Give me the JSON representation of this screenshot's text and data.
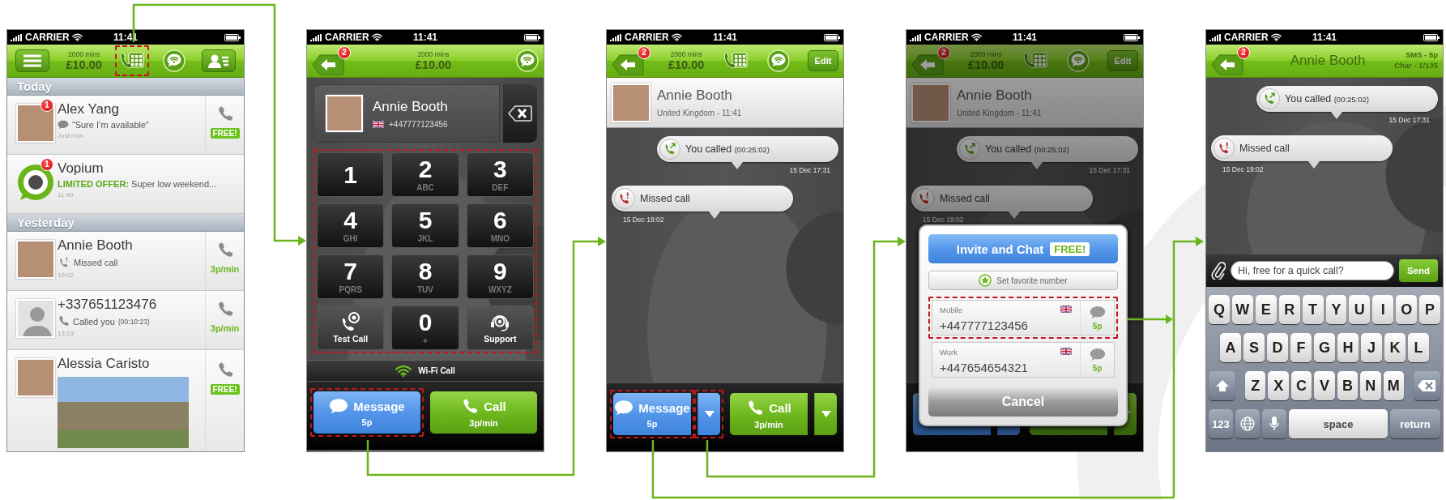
{
  "screens": [
    {
      "kind": "call_log",
      "status_bar": {
        "carrier": "CARRIER",
        "time": "11:41"
      },
      "header": [
        {
          "kind": "menu",
          "highlighted": false
        },
        {
          "kind": "credit",
          "minutes": "2000 mins",
          "balance": "£10.00",
          "highlighted": false
        },
        {
          "kind": "dialpad",
          "highlighted": true
        },
        {
          "kind": "wifi",
          "highlighted": false
        },
        {
          "kind": "contacts",
          "highlighted": false
        }
      ],
      "sections": [
        {
          "title": "Today",
          "items": [
            {
              "kind": "message",
              "avatar": {
                "kind": "photo"
              },
              "badge": "1",
              "name": "Alex Yang",
              "detail": "“Sure I’m available”",
              "time": "Just now",
              "rate": {
                "kind": "badge",
                "text": "FREE!"
              }
            },
            {
              "kind": "promo",
              "avatar": {
                "kind": "logo"
              },
              "badge": "1",
              "name": "Vopium",
              "detail": "**LIMITED OFFER:** Super low weekend...",
              "time": "11:40"
            }
          ]
        },
        {
          "title": "Yesterday",
          "items": [
            {
              "kind": "missed",
              "avatar": {
                "kind": "photo"
              },
              "name": "Annie Booth",
              "detail": "Missed call",
              "time": "19:02",
              "rate": {
                "kind": "text",
                "text": "3p/min"
              }
            },
            {
              "kind": "incoming",
              "avatar": {
                "kind": "silhouette"
              },
              "name": "+337651123476",
              "detail": "Called you",
              "duration": "(00:10:23)",
              "time": "13:23",
              "rate": {
                "kind": "text",
                "text": "3p/min"
              }
            },
            {
              "kind": "photo",
              "avatar": {
                "kind": "photo"
              },
              "name": "Alessia Caristo",
              "rate": {
                "kind": "badge",
                "text": "FREE!"
              }
            }
          ]
        }
      ]
    },
    {
      "kind": "dialer",
      "status_bar": {
        "carrier": "CARRIER",
        "time": "11:41"
      },
      "header": [
        {
          "kind": "back",
          "badge": "2"
        },
        {
          "kind": "credit",
          "minutes": "2000 mins",
          "balance": "£10.00"
        },
        {
          "kind": "wifi"
        }
      ],
      "contact": {
        "name": "Annie Booth",
        "number": "+447777123456"
      },
      "keypad": {
        "highlighted": true,
        "keys": [
          {
            "kind": "digit",
            "digit": "1"
          },
          {
            "kind": "digit",
            "digit": "2",
            "letters": "ABC"
          },
          {
            "kind": "digit",
            "digit": "3",
            "letters": "DEF"
          },
          {
            "kind": "digit",
            "digit": "4",
            "letters": "GHI"
          },
          {
            "kind": "digit",
            "digit": "5",
            "letters": "JKL"
          },
          {
            "kind": "digit",
            "digit": "6",
            "letters": "MNO"
          },
          {
            "kind": "digit",
            "digit": "7",
            "letters": "PQRS"
          },
          {
            "kind": "digit",
            "digit": "8",
            "letters": "TUV"
          },
          {
            "kind": "digit",
            "digit": "9",
            "letters": "WXYZ"
          },
          {
            "kind": "test_call",
            "label": "Test Call"
          },
          {
            "kind": "digit",
            "digit": "0",
            "letters": "+"
          },
          {
            "kind": "support",
            "label": "Support"
          }
        ]
      },
      "call_mode": "Wi-Fi Call",
      "buttons": [
        {
          "kind": "message",
          "label": "Message",
          "price": "5p",
          "dropdown": false,
          "highlighted": true
        },
        {
          "kind": "call",
          "label": "Call",
          "price": "3p/min",
          "dropdown": false,
          "highlighted": false
        }
      ]
    },
    {
      "kind": "conversation",
      "status_bar": {
        "carrier": "CARRIER",
        "time": "11:41"
      },
      "header": [
        {
          "kind": "back",
          "badge": "2"
        },
        {
          "kind": "credit",
          "minutes": "2000 mins",
          "balance": "£10.00"
        },
        {
          "kind": "dialpad"
        },
        {
          "kind": "wifi"
        },
        {
          "kind": "edit",
          "label": "Edit"
        }
      ],
      "contact": {
        "name": "Annie Booth",
        "subtitle": "United Kingdom - 11:41"
      },
      "messages": [
        {
          "kind": "outgoing",
          "text": "You called",
          "duration": "(00:25:02)",
          "time": "15 Dec 17:31"
        },
        {
          "kind": "missed",
          "text": "Missed call",
          "time": "15 Dec 19:02"
        }
      ],
      "buttons": [
        {
          "kind": "message",
          "label": "Message",
          "price": "5p",
          "dropdown": true,
          "highlighted": true,
          "dropdown_highlighted": true
        },
        {
          "kind": "call",
          "label": "Call",
          "price": "3p/min",
          "dropdown": true,
          "highlighted": false,
          "dropdown_highlighted": false
        }
      ]
    },
    {
      "kind": "number_picker",
      "status_bar": {
        "carrier": "CARRIER",
        "time": "11:41"
      },
      "header": [
        {
          "kind": "back",
          "badge": "2"
        },
        {
          "kind": "credit",
          "minutes": "2000 mins",
          "balance": "£10.00"
        },
        {
          "kind": "dialpad"
        },
        {
          "kind": "wifi"
        },
        {
          "kind": "edit",
          "label": "Edit"
        }
      ],
      "contact": {
        "name": "Annie Booth",
        "subtitle": "United Kingdom - 11:41"
      },
      "messages": [
        {
          "kind": "outgoing",
          "text": "You called",
          "duration": "(00:25:02)",
          "time": "15 Dec 17:31"
        },
        {
          "kind": "missed",
          "text": "Missed call",
          "time": "15 Dec 19:02"
        }
      ],
      "buttons": [
        {
          "kind": "message",
          "dropdown": true
        },
        {
          "kind": "call",
          "dropdown": true
        }
      ],
      "popup": {
        "invite": "Invite and Chat",
        "invite_badge": "FREE!",
        "favorite": "Set favorite number",
        "numbers": [
          {
            "label": "Mobile",
            "number": "+447777123456",
            "price": "5p",
            "highlighted": true
          },
          {
            "label": "Work",
            "number": "+447654654321",
            "price": "5p",
            "highlighted": false
          }
        ],
        "cancel": "Cancel"
      }
    },
    {
      "kind": "compose",
      "status_bar": {
        "carrier": "CARRIER",
        "time": "11:41"
      },
      "header": [
        {
          "kind": "back",
          "badge": "2"
        },
        {
          "kind": "title",
          "text": "Annie Booth"
        },
        {
          "kind": "sms_info",
          "lines": [
            "SMS - 5p",
            "Char - 1/135"
          ]
        }
      ],
      "messages": [
        {
          "kind": "outgoing",
          "text": "You called",
          "duration": "(00:25:02)",
          "time": "15 Dec 17:31"
        },
        {
          "kind": "missed",
          "text": "Missed call",
          "time": "15 Dec 19:02"
        }
      ],
      "composer": {
        "value": "Hi, free for a quick call?",
        "send": "Send"
      },
      "keyboard": {
        "rows": [
          [
            "Q",
            "W",
            "E",
            "R",
            "T",
            "Y",
            "U",
            "I",
            "O",
            "P"
          ],
          [
            "A",
            "S",
            "D",
            "F",
            "G",
            "H",
            "J",
            "K",
            "L"
          ],
          [
            "Z",
            "X",
            "C",
            "V",
            "B",
            "N",
            "M"
          ]
        ],
        "numbers": "123",
        "space": "space",
        "return": "return"
      }
    }
  ]
}
